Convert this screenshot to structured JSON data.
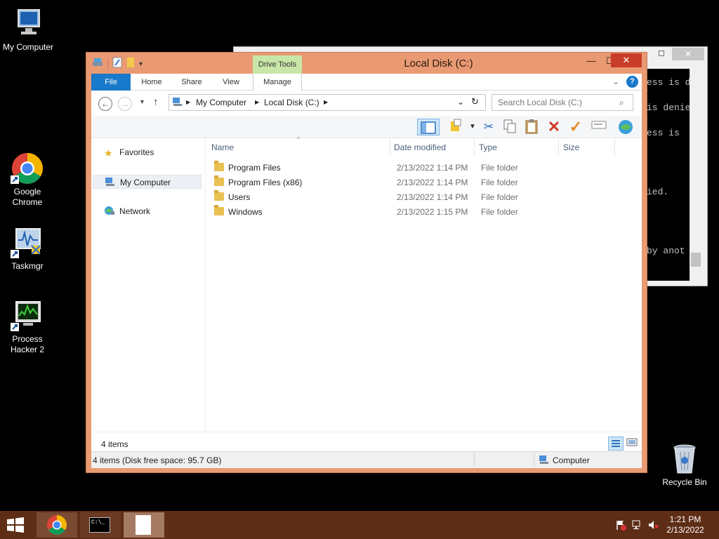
{
  "desktop": {
    "icons": [
      {
        "label": "My Computer",
        "icon": "computer-icon"
      },
      {
        "label": "Google Chrome",
        "icon": "chrome-icon"
      },
      {
        "label": "Taskmgr",
        "icon": "taskmgr-icon"
      },
      {
        "label": "Process Hacker 2",
        "icon": "process-hacker-icon"
      },
      {
        "label": "Recycle Bin",
        "icon": "recycle-bin-icon"
      }
    ]
  },
  "console": {
    "lines": [
      "ess is d",
      "is denie",
      "ess is",
      "ied.",
      "by anot"
    ],
    "close_label": "✕",
    "max_label": "☐"
  },
  "explorer": {
    "title": "Local Disk (C:)",
    "context_tab_group": "Drive Tools",
    "tabs": {
      "file": "File",
      "home": "Home",
      "share": "Share",
      "view": "View",
      "manage": "Manage"
    },
    "breadcrumb": {
      "root": "My Computer",
      "current": "Local Disk (C:)"
    },
    "search_placeholder": "Search Local Disk (C:)",
    "navpane": {
      "favorites": "Favorites",
      "computer": "My Computer",
      "network": "Network"
    },
    "columns": {
      "name": "Name",
      "date": "Date modified",
      "type": "Type",
      "size": "Size"
    },
    "files": [
      {
        "name": "Program Files",
        "date": "2/13/2022 1:14 PM",
        "type": "File folder"
      },
      {
        "name": "Program Files (x86)",
        "date": "2/13/2022 1:14 PM",
        "type": "File folder"
      },
      {
        "name": "Users",
        "date": "2/13/2022 1:14 PM",
        "type": "File folder"
      },
      {
        "name": "Windows",
        "date": "2/13/2022 1:15 PM",
        "type": "File folder"
      }
    ],
    "item_count": "4 items",
    "status_left": "4 items (Disk free space: 95.7 GB)",
    "status_right": "Computer"
  },
  "taskbar": {
    "time": "1:21 PM",
    "date": "2/13/2022",
    "console_label": "C:\\_"
  },
  "colors": {
    "window_frame": "#e99a72",
    "file_tab": "#1979ca",
    "drive_tools": "#c8e6a8",
    "taskbar": "#5e2d16",
    "close_button": "#c83c2a"
  }
}
